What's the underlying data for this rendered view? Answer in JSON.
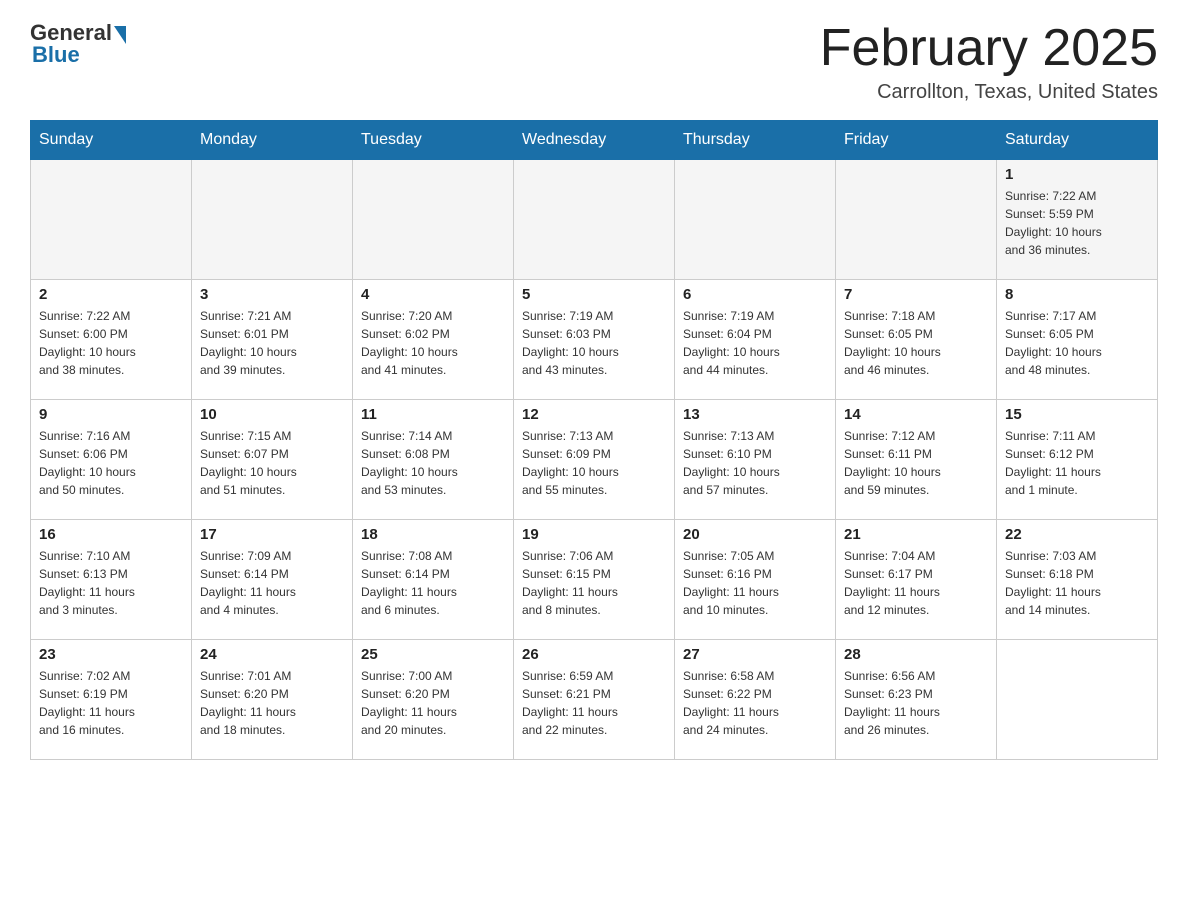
{
  "header": {
    "logo": {
      "general_text": "General",
      "blue_text": "Blue"
    },
    "title": "February 2025",
    "location": "Carrollton, Texas, United States"
  },
  "days_of_week": [
    "Sunday",
    "Monday",
    "Tuesday",
    "Wednesday",
    "Thursday",
    "Friday",
    "Saturday"
  ],
  "weeks": [
    {
      "days": [
        {
          "number": "",
          "info": ""
        },
        {
          "number": "",
          "info": ""
        },
        {
          "number": "",
          "info": ""
        },
        {
          "number": "",
          "info": ""
        },
        {
          "number": "",
          "info": ""
        },
        {
          "number": "",
          "info": ""
        },
        {
          "number": "1",
          "info": "Sunrise: 7:22 AM\nSunset: 5:59 PM\nDaylight: 10 hours\nand 36 minutes."
        }
      ]
    },
    {
      "days": [
        {
          "number": "2",
          "info": "Sunrise: 7:22 AM\nSunset: 6:00 PM\nDaylight: 10 hours\nand 38 minutes."
        },
        {
          "number": "3",
          "info": "Sunrise: 7:21 AM\nSunset: 6:01 PM\nDaylight: 10 hours\nand 39 minutes."
        },
        {
          "number": "4",
          "info": "Sunrise: 7:20 AM\nSunset: 6:02 PM\nDaylight: 10 hours\nand 41 minutes."
        },
        {
          "number": "5",
          "info": "Sunrise: 7:19 AM\nSunset: 6:03 PM\nDaylight: 10 hours\nand 43 minutes."
        },
        {
          "number": "6",
          "info": "Sunrise: 7:19 AM\nSunset: 6:04 PM\nDaylight: 10 hours\nand 44 minutes."
        },
        {
          "number": "7",
          "info": "Sunrise: 7:18 AM\nSunset: 6:05 PM\nDaylight: 10 hours\nand 46 minutes."
        },
        {
          "number": "8",
          "info": "Sunrise: 7:17 AM\nSunset: 6:05 PM\nDaylight: 10 hours\nand 48 minutes."
        }
      ]
    },
    {
      "days": [
        {
          "number": "9",
          "info": "Sunrise: 7:16 AM\nSunset: 6:06 PM\nDaylight: 10 hours\nand 50 minutes."
        },
        {
          "number": "10",
          "info": "Sunrise: 7:15 AM\nSunset: 6:07 PM\nDaylight: 10 hours\nand 51 minutes."
        },
        {
          "number": "11",
          "info": "Sunrise: 7:14 AM\nSunset: 6:08 PM\nDaylight: 10 hours\nand 53 minutes."
        },
        {
          "number": "12",
          "info": "Sunrise: 7:13 AM\nSunset: 6:09 PM\nDaylight: 10 hours\nand 55 minutes."
        },
        {
          "number": "13",
          "info": "Sunrise: 7:13 AM\nSunset: 6:10 PM\nDaylight: 10 hours\nand 57 minutes."
        },
        {
          "number": "14",
          "info": "Sunrise: 7:12 AM\nSunset: 6:11 PM\nDaylight: 10 hours\nand 59 minutes."
        },
        {
          "number": "15",
          "info": "Sunrise: 7:11 AM\nSunset: 6:12 PM\nDaylight: 11 hours\nand 1 minute."
        }
      ]
    },
    {
      "days": [
        {
          "number": "16",
          "info": "Sunrise: 7:10 AM\nSunset: 6:13 PM\nDaylight: 11 hours\nand 3 minutes."
        },
        {
          "number": "17",
          "info": "Sunrise: 7:09 AM\nSunset: 6:14 PM\nDaylight: 11 hours\nand 4 minutes."
        },
        {
          "number": "18",
          "info": "Sunrise: 7:08 AM\nSunset: 6:14 PM\nDaylight: 11 hours\nand 6 minutes."
        },
        {
          "number": "19",
          "info": "Sunrise: 7:06 AM\nSunset: 6:15 PM\nDaylight: 11 hours\nand 8 minutes."
        },
        {
          "number": "20",
          "info": "Sunrise: 7:05 AM\nSunset: 6:16 PM\nDaylight: 11 hours\nand 10 minutes."
        },
        {
          "number": "21",
          "info": "Sunrise: 7:04 AM\nSunset: 6:17 PM\nDaylight: 11 hours\nand 12 minutes."
        },
        {
          "number": "22",
          "info": "Sunrise: 7:03 AM\nSunset: 6:18 PM\nDaylight: 11 hours\nand 14 minutes."
        }
      ]
    },
    {
      "days": [
        {
          "number": "23",
          "info": "Sunrise: 7:02 AM\nSunset: 6:19 PM\nDaylight: 11 hours\nand 16 minutes."
        },
        {
          "number": "24",
          "info": "Sunrise: 7:01 AM\nSunset: 6:20 PM\nDaylight: 11 hours\nand 18 minutes."
        },
        {
          "number": "25",
          "info": "Sunrise: 7:00 AM\nSunset: 6:20 PM\nDaylight: 11 hours\nand 20 minutes."
        },
        {
          "number": "26",
          "info": "Sunrise: 6:59 AM\nSunset: 6:21 PM\nDaylight: 11 hours\nand 22 minutes."
        },
        {
          "number": "27",
          "info": "Sunrise: 6:58 AM\nSunset: 6:22 PM\nDaylight: 11 hours\nand 24 minutes."
        },
        {
          "number": "28",
          "info": "Sunrise: 6:56 AM\nSunset: 6:23 PM\nDaylight: 11 hours\nand 26 minutes."
        },
        {
          "number": "",
          "info": ""
        }
      ]
    }
  ]
}
